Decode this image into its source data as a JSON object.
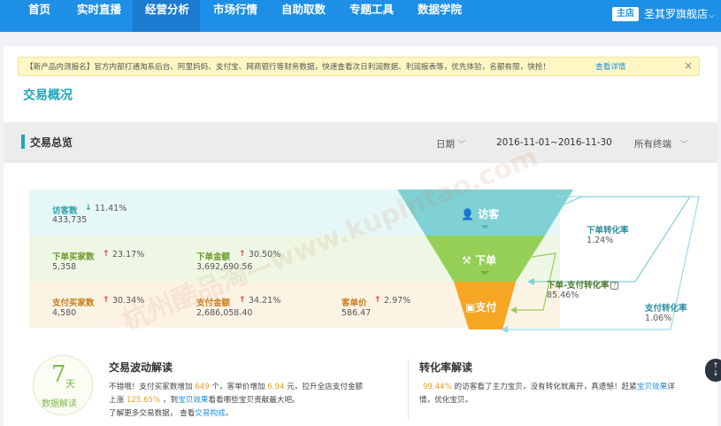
{
  "nav": {
    "items": [
      "首页",
      "实时直播",
      "经营分析",
      "市场行情",
      "自助取数",
      "专题工具",
      "数据学院"
    ],
    "active_index": 2,
    "shop_badge": "主店",
    "shop_name": "圣其罗旗舰店"
  },
  "notice": {
    "text": "【新产品内测报名】官方内部打通淘系后台、阿里妈妈、支付宝、网商银行等财务数据，快速查看次日利润数据、利润报表等，优先体验，名额有限，快抢！",
    "link": "查看详情",
    "close": "×"
  },
  "section_title": "交易概况",
  "filter": {
    "title": "交易总览",
    "date_label": "日期",
    "date_range": "2016-11-01~2016-11-30",
    "terminal": "所有终端"
  },
  "metrics": {
    "visitors": {
      "label": "访客数",
      "pct": "11.41%",
      "value": "433,735",
      "direction": "down"
    },
    "order_buyers": {
      "label": "下单买家数",
      "pct": "23.17%",
      "value": "5,358",
      "direction": "up"
    },
    "order_amount": {
      "label": "下单金额",
      "pct": "30.50%",
      "value": "3,692,690.56",
      "direction": "up"
    },
    "pay_buyers": {
      "label": "支付买家数",
      "pct": "30.34%",
      "value": "4,580",
      "direction": "up"
    },
    "pay_amount": {
      "label": "支付金额",
      "pct": "34.21%",
      "value": "2,686,058.40",
      "direction": "up"
    },
    "unit_price": {
      "label": "客单价",
      "pct": "2.97%",
      "value": "586.47",
      "direction": "up"
    }
  },
  "funnel": {
    "visit": "访客",
    "order": "下单",
    "pay": "支付",
    "colors": {
      "visit": "#7fd1d4",
      "order": "#95cf56",
      "pay": "#f6a623"
    }
  },
  "rates": {
    "order_conv": {
      "label": "下单转化率",
      "value": "1.24%"
    },
    "order_pay_conv": {
      "label": "下单-支付转化率",
      "value": "85.46%"
    },
    "pay_conv": {
      "label": "支付转化率",
      "value": "1.06%"
    }
  },
  "seven_day": {
    "num": "7",
    "unit": "天",
    "text": "数据解读"
  },
  "fluctuation": {
    "title": "交易波动解读",
    "l1_a": "不错哦！支付买家数增加",
    "l1_n1": "649",
    "l1_b": "个，客单价增加",
    "l1_n2": "6.94",
    "l1_c": "元，拉升全店支付金额",
    "l2_a": "上涨",
    "l2_n": "125.65%",
    "l2_b": "，到",
    "l2_link": "宝贝效果",
    "l2_c": "看看哪些宝贝贡献最大吧。",
    "l3_a": "了解更多交易数据，",
    "l3_b": "查看",
    "l3_link": "交易构成",
    "l3_c": "。"
  },
  "conversion": {
    "title": "转化率解读",
    "l1_n": "99.44%",
    "l1_a": "的访客看了主力宝贝，没有转化就离开，真遗憾！赶紧",
    "l1_link": "宝贝效果",
    "l1_b": "详",
    "l2": "情，优化宝贝。"
  },
  "watermark": "杭州酷品淘—www.kupintao.com"
}
